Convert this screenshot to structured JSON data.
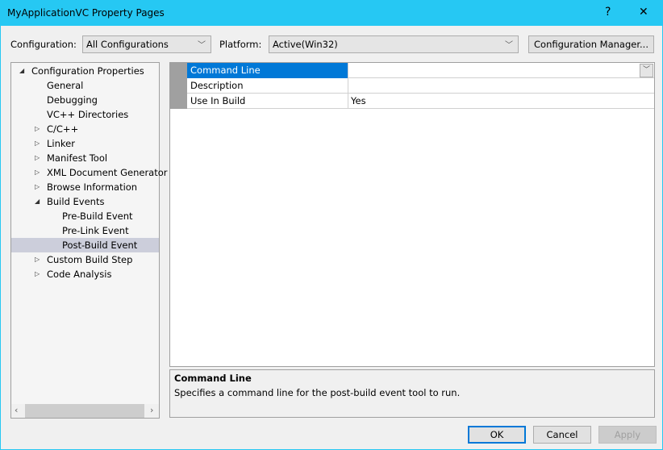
{
  "window": {
    "title": "MyApplicationVC Property Pages",
    "help": "?",
    "close": "✕"
  },
  "toolbar": {
    "configuration_label": "Configuration:",
    "configuration_value": "All Configurations",
    "platform_label": "Platform:",
    "platform_value": "Active(Win32)",
    "config_manager": "Configuration Manager..."
  },
  "tree": [
    {
      "label": "Configuration Properties",
      "level": 0,
      "expander": "expanded"
    },
    {
      "label": "General",
      "level": 1
    },
    {
      "label": "Debugging",
      "level": 1
    },
    {
      "label": "VC++ Directories",
      "level": 1
    },
    {
      "label": "C/C++",
      "level": 1,
      "expander": "collapsed"
    },
    {
      "label": "Linker",
      "level": 1,
      "expander": "collapsed"
    },
    {
      "label": "Manifest Tool",
      "level": 1,
      "expander": "collapsed"
    },
    {
      "label": "XML Document Generator",
      "level": 1,
      "expander": "collapsed"
    },
    {
      "label": "Browse Information",
      "level": 1,
      "expander": "collapsed"
    },
    {
      "label": "Build Events",
      "level": 1,
      "expander": "expanded"
    },
    {
      "label": "Pre-Build Event",
      "level": 2
    },
    {
      "label": "Pre-Link Event",
      "level": 2
    },
    {
      "label": "Post-Build Event",
      "level": 2,
      "selected": true
    },
    {
      "label": "Custom Build Step",
      "level": 1,
      "expander": "collapsed"
    },
    {
      "label": "Code Analysis",
      "level": 1,
      "expander": "collapsed"
    }
  ],
  "grid": {
    "rows": [
      {
        "name": "Command Line",
        "value": "",
        "selected": true
      },
      {
        "name": "Description",
        "value": ""
      },
      {
        "name": "Use In Build",
        "value": "Yes"
      }
    ]
  },
  "description": {
    "title": "Command Line",
    "text": "Specifies a command line for the post-build event tool to run."
  },
  "buttons": {
    "ok": "OK",
    "cancel": "Cancel",
    "apply": "Apply"
  }
}
